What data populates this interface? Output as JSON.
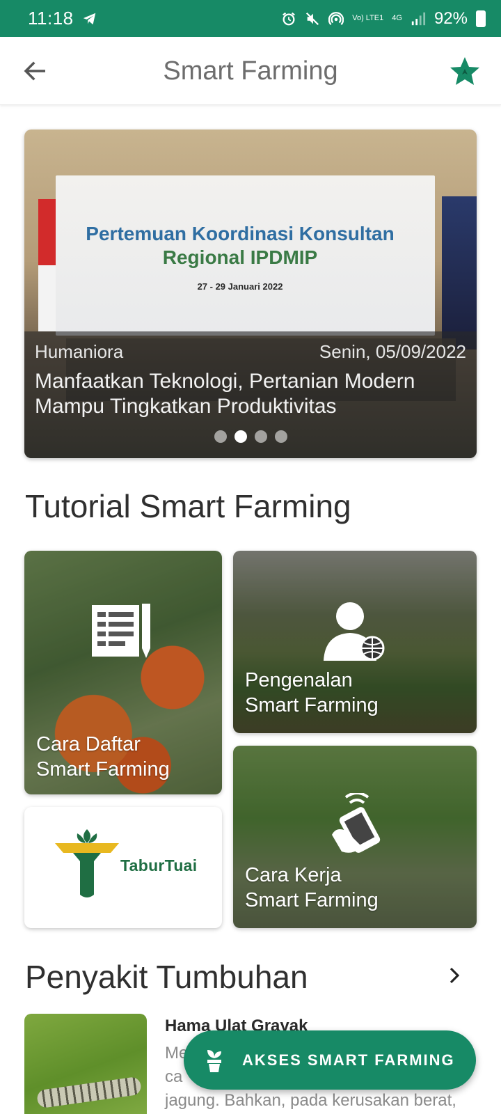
{
  "status_bar": {
    "time": "11:18",
    "network_label": "Vo) LTE1",
    "data_label": "4G",
    "battery": "92%"
  },
  "app_bar": {
    "title": "Smart Farming"
  },
  "banner": {
    "backdrop_line1": "Pertemuan Koordinasi Konsultan",
    "backdrop_line2": "Regional IPDMIP",
    "backdrop_small": "27 - 29 Januari 2022",
    "category": "Humaniora",
    "date": "Senin, 05/09/2022",
    "headline": "Manfaatkan Teknologi, Pertanian Modern Mampu Tingkatkan Produktivitas",
    "slide_count": 4,
    "active_slide": 2
  },
  "tutorial": {
    "heading": "Tutorial Smart Farming",
    "cards": {
      "daftar": {
        "line1": "Cara Daftar",
        "line2": "Smart Farming"
      },
      "pengenalan": {
        "line1": "Pengenalan",
        "line2": "Smart Farming"
      },
      "kerja": {
        "line1": "Cara Kerja",
        "line2": "Smart Farming"
      },
      "logo": {
        "text": "TaburTuai"
      }
    }
  },
  "penyakit": {
    "heading": "Penyakit Tumbuhan",
    "items": [
      {
        "title": "Hama Ulat Grayak",
        "desc_visible_fragments": [
          "Me",
          "ca",
          "jagung. Bahkan, pada kerusakan berat,"
        ]
      }
    ]
  },
  "fab": {
    "label": "AKSES SMART FARMING"
  },
  "colors": {
    "primary": "#178a66",
    "heading_text": "#2f2f2f",
    "muted_text": "#8a8a8a"
  }
}
